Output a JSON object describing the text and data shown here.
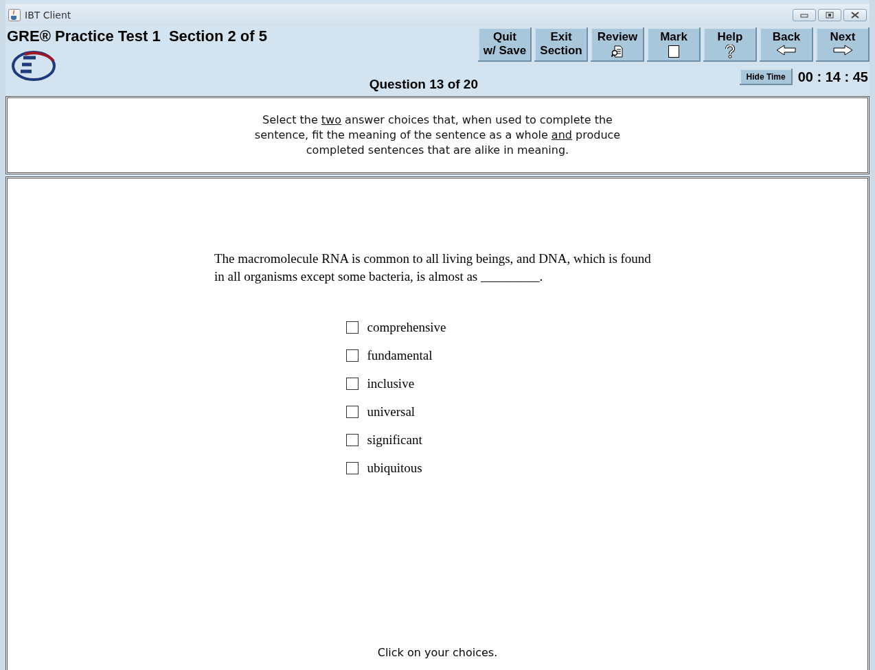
{
  "window": {
    "title": "IBT Client"
  },
  "header": {
    "title": "GRE® Practice Test 1  Section 2 of 5",
    "question": "Question 13 of 20",
    "hide_time": "Hide Time",
    "timer": "00 : 14 : 45"
  },
  "toolbar": [
    {
      "kind": "text",
      "lines": [
        "Quit",
        "w/ Save"
      ]
    },
    {
      "kind": "text",
      "lines": [
        "Exit",
        "Section"
      ]
    },
    {
      "kind": "review",
      "lines": [
        "Review"
      ]
    },
    {
      "kind": "mark",
      "lines": [
        "Mark"
      ]
    },
    {
      "kind": "help",
      "lines": [
        "Help"
      ]
    },
    {
      "kind": "back",
      "lines": [
        "Back"
      ]
    },
    {
      "kind": "next",
      "lines": [
        "Next"
      ]
    }
  ],
  "instructions": [
    {
      "text": "Select the ",
      "underline": false
    },
    {
      "text": "two",
      "underline": true
    },
    {
      "text": " answer choices that, when used to complete the sentence, fit the meaning of the sentence as a whole ",
      "underline": false
    },
    {
      "text": "and",
      "underline": true
    },
    {
      "text": " produce completed sentences that are alike in meaning.",
      "underline": false
    }
  ],
  "question": "The macromolecule RNA is common to all living beings, and DNA, which is found in all organisms except some bacteria, is almost as _________.",
  "choices": [
    {
      "label": "comprehensive",
      "checked": false
    },
    {
      "label": "fundamental",
      "checked": false
    },
    {
      "label": "inclusive",
      "checked": false
    },
    {
      "label": "universal",
      "checked": false
    },
    {
      "label": "significant",
      "checked": false
    },
    {
      "label": "ubiquitous",
      "checked": false
    }
  ],
  "footer": "Click on your choices."
}
